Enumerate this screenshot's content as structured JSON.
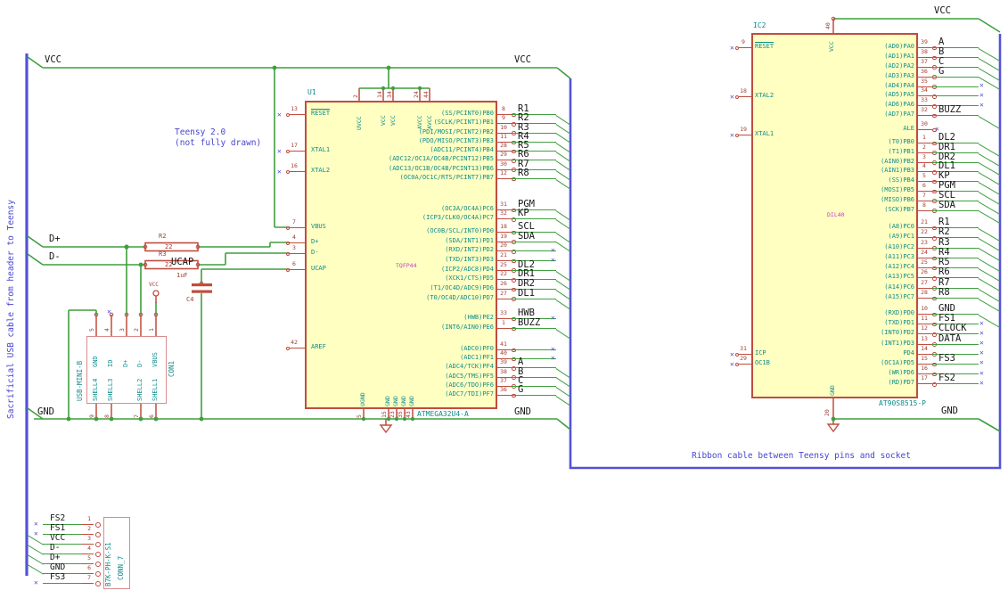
{
  "notes": {
    "teensy_line1": "Teensy 2.0",
    "teensy_line2": "(not fully drawn)",
    "ribbon": "Ribbon cable between Teensy pins and socket",
    "sacrificial": "Sacrificial USB cable from header to Teensy"
  },
  "net_labels": {
    "vcc": "VCC",
    "gnd": "GND",
    "d_plus": "D+",
    "d_minus": "D-",
    "ucap": "UCAP"
  },
  "colors": {
    "wire": "#3f9f3f",
    "bus": "#5353d6",
    "pin_outline": "#bf4d3f",
    "body_fill": "#ffffc2",
    "pin_name": "#0e8c8c",
    "pin_number": "#a33c32",
    "net_label": "#161616",
    "note_blue": "#4646cf",
    "footprint_magenta": "#c43fc4"
  },
  "u1": {
    "ref": "U1",
    "value": "ATMEGA32U4-A",
    "footprint": "TQFP44",
    "top_pins": [
      {
        "num": "2",
        "name": "UVCC"
      },
      {
        "num": "14",
        "name": "VCC"
      },
      {
        "num": "34",
        "name": "VCC"
      },
      {
        "num": "24",
        "name": "AVCC"
      },
      {
        "num": "44",
        "name": "AVCC"
      }
    ],
    "bottom_pins": [
      {
        "num": "5",
        "name": "UGND"
      },
      {
        "num": "15",
        "name": "GND"
      },
      {
        "num": "23",
        "name": "GND"
      },
      {
        "num": "35",
        "name": "GND"
      },
      {
        "num": "43",
        "name": "GND"
      }
    ],
    "left_pins": [
      {
        "num": "13",
        "name": "RESET"
      },
      {
        "num": "17",
        "name": "XTAL1"
      },
      {
        "num": "16",
        "name": "XTAL2"
      },
      {
        "num": "7",
        "name": "VBUS"
      },
      {
        "num": "4",
        "name": "D+"
      },
      {
        "num": "3",
        "name": "D-"
      },
      {
        "num": "6",
        "name": "UCAP"
      },
      {
        "num": "42",
        "name": "AREF"
      }
    ],
    "right_groups": [
      {
        "rows": [
          {
            "name": "(SS/PCINT0)PB0",
            "num": "8",
            "net": "R1",
            "entry": true
          },
          {
            "name": "(SCLK/PCINT1)PB1",
            "num": "9",
            "net": "R2",
            "entry": true
          },
          {
            "name": "(PDI/MOSI/PCINT2)PB2",
            "num": "10",
            "net": "R3",
            "entry": true
          },
          {
            "name": "(PDO/MISO/PCINT3)PB3",
            "num": "11",
            "net": "R4",
            "entry": true
          },
          {
            "name": "(ADC11/PCINT4)PB4",
            "num": "28",
            "net": "R5",
            "entry": true
          },
          {
            "name": "(ADC12/OC1A/OC4B/PCINT12)PB5",
            "num": "29",
            "net": "R6",
            "entry": true
          },
          {
            "name": "(ADC13/OC1B/OC4B/PCINT13)PB6",
            "num": "30",
            "net": "R7",
            "entry": true
          },
          {
            "name": "(OC0A/OC1C/RTS/PCINT7)PB7",
            "num": "12",
            "net": "R8",
            "entry": true
          }
        ]
      },
      {
        "rows": [
          {
            "name": "(OC3A/OC4A)PC6",
            "num": "31",
            "net": "PGM",
            "entry": true
          },
          {
            "name": "(ICP3/CLK0/OC4A)PC7",
            "num": "32",
            "net": "KP",
            "entry": true
          }
        ]
      },
      {
        "rows": [
          {
            "name": "(OC0B/SCL/INT0)PD0",
            "num": "18",
            "net": "SCL",
            "entry": true
          },
          {
            "name": "(SDA/INT1)PD1",
            "num": "19",
            "net": "SDA",
            "entry": true
          },
          {
            "name": "(RXD/INT2)PD2",
            "num": "20",
            "nc": true
          },
          {
            "name": "(TXD/INT3)PD3",
            "num": "21",
            "nc": true
          },
          {
            "name": "(ICP2/ADC8)PD4",
            "num": "25",
            "net": "DL2",
            "entry": true
          },
          {
            "name": "(XCK1/CTS)PD5",
            "num": "22",
            "net": "DR1",
            "entry": true
          },
          {
            "name": "(T1/OC4D/ADC9)PD6",
            "num": "26",
            "net": "DR2",
            "entry": true
          },
          {
            "name": "(T0/OC4D/ADC10)PD7",
            "num": "27",
            "net": "DL1",
            "entry": true
          }
        ]
      },
      {
        "rows": [
          {
            "name": "(HWB)PE2",
            "num": "33",
            "net": "HWB",
            "nc": true
          },
          {
            "name": "(INT6/AIN0)PE6",
            "num": "1",
            "net": "BUZZ",
            "entry": true
          }
        ]
      },
      {
        "rows": [
          {
            "name": "(ADC0)PF0",
            "num": "41",
            "nc": true
          },
          {
            "name": "(ADC1)PF1",
            "num": "40",
            "nc": true
          },
          {
            "name": "(ADC4/TCK)PF4",
            "num": "39",
            "net": "A",
            "entry": true
          },
          {
            "name": "(ADC5/TMS)PF5",
            "num": "38",
            "net": "B",
            "entry": true
          },
          {
            "name": "(ADC6/TDO)PF6",
            "num": "37",
            "net": "C",
            "entry": true
          },
          {
            "name": "(ADC7/TDI)PF7",
            "num": "36",
            "net": "G",
            "entry": true
          }
        ]
      }
    ]
  },
  "ic2": {
    "ref": "IC2",
    "value": "AT90S8515-P",
    "footprint": "DIL40",
    "top_pin": {
      "num": "40",
      "name": "VCC"
    },
    "bottom_pin": {
      "num": "20",
      "name": "GND"
    },
    "ale_pin": {
      "name": "ALE",
      "num": "30"
    },
    "left_pins": [
      {
        "num": "9",
        "name": "RESET"
      },
      {
        "num": "18",
        "name": "XTAL2"
      },
      {
        "num": "19",
        "name": "XTAL1"
      },
      {
        "num": "31",
        "name": "ICP"
      },
      {
        "num": "29",
        "name": "OC1B"
      }
    ],
    "right_groups": [
      {
        "rows": [
          {
            "name": "(AD0)PA0",
            "num": "39",
            "net": "A",
            "entry": true
          },
          {
            "name": "(AD1)PA1",
            "num": "38",
            "net": "B",
            "entry": true
          },
          {
            "name": "(AD2)PA2",
            "num": "37",
            "net": "C",
            "entry": true
          },
          {
            "name": "(AD3)PA3",
            "num": "36",
            "net": "G",
            "entry": true
          },
          {
            "name": "(AD4)PA4",
            "num": "35",
            "nc": true
          },
          {
            "name": "(AD5)PA5",
            "num": "34",
            "nc": true
          },
          {
            "name": "(AD6)PA6",
            "num": "33",
            "nc": true
          },
          {
            "name": "(AD7)PA7",
            "num": "32",
            "net": "BUZZ",
            "entry": true
          }
        ]
      },
      {
        "rows": [
          {
            "name": "(T0)PB0",
            "num": "1",
            "net": "DL2",
            "entry": true
          },
          {
            "name": "(T1)PB1",
            "num": "2",
            "net": "DR1",
            "entry": true
          },
          {
            "name": "(AIN0)PB2",
            "num": "3",
            "net": "DR2",
            "entry": true
          },
          {
            "name": "(AIN1)PB3",
            "num": "4",
            "net": "DL1",
            "entry": true
          },
          {
            "name": "(SS)PB4",
            "num": "5",
            "net": "KP",
            "entry": true
          },
          {
            "name": "(MOSI)PB5",
            "num": "6",
            "net": "PGM",
            "entry": true
          },
          {
            "name": "(MISO)PB6",
            "num": "7",
            "net": "SCL",
            "entry": true
          },
          {
            "name": "(SCK)PB7",
            "num": "8",
            "net": "SDA",
            "entry": true
          }
        ]
      },
      {
        "rows": [
          {
            "name": "(A8)PC0",
            "num": "21",
            "net": "R1",
            "entry": true
          },
          {
            "name": "(A9)PC1",
            "num": "22",
            "net": "R2",
            "entry": true
          },
          {
            "name": "(A10)PC2",
            "num": "23",
            "net": "R3",
            "entry": true
          },
          {
            "name": "(A11)PC3",
            "num": "24",
            "net": "R4",
            "entry": true
          },
          {
            "name": "(A12)PC4",
            "num": "25",
            "net": "R5",
            "entry": true
          },
          {
            "name": "(A13)PC5",
            "num": "26",
            "net": "R6",
            "entry": true
          },
          {
            "name": "(A14)PC6",
            "num": "27",
            "net": "R7",
            "entry": true
          },
          {
            "name": "(A15)PC7",
            "num": "28",
            "net": "R8",
            "entry": true
          }
        ]
      },
      {
        "rows": [
          {
            "name": "(RXD)PD0",
            "num": "10",
            "net": "GND",
            "entry": true
          },
          {
            "name": "(TXD)PD1",
            "num": "11",
            "net": "FS1",
            "nc": true
          },
          {
            "name": "(INT0)PD2",
            "num": "12",
            "net": "CLOCK",
            "nc": true
          },
          {
            "name": "(INT1)PD3",
            "num": "13",
            "net": "DATA",
            "nc": true
          },
          {
            "name": "PD4",
            "num": "14",
            "nc": true
          },
          {
            "name": "(OC1A)PD5",
            "num": "15",
            "net": "FS3",
            "nc": true
          },
          {
            "name": "(WR)PD6",
            "num": "16",
            "nc": true
          },
          {
            "name": "(RD)PD7",
            "num": "17",
            "net": "FS2",
            "nc": true
          }
        ]
      }
    ]
  },
  "usb": {
    "ref": "CON1",
    "value": "USB-MINI-B",
    "top_pins": [
      {
        "num": "5",
        "name": "GND"
      },
      {
        "num": "4",
        "name": "ID"
      },
      {
        "num": "3",
        "name": "D+"
      },
      {
        "num": "2",
        "name": "D-"
      },
      {
        "num": "1",
        "name": "VBUS"
      }
    ],
    "bottom_pins": [
      {
        "num": "9",
        "name": "SHELL4"
      },
      {
        "num": "8",
        "name": "SHELL3"
      },
      {
        "num": "7",
        "name": "SHELL2"
      },
      {
        "num": "6",
        "name": "SHELL1"
      }
    ]
  },
  "conn7": {
    "ref": "CONN_7",
    "value": "B7K-PH-K-S1",
    "rows": [
      {
        "num": "1",
        "net": "FS2",
        "nc": true
      },
      {
        "num": "2",
        "net": "FS1",
        "nc": true
      },
      {
        "num": "3",
        "net": "VCC",
        "entry": true
      },
      {
        "num": "4",
        "net": "D-",
        "entry": true
      },
      {
        "num": "5",
        "net": "D+",
        "entry": true
      },
      {
        "num": "6",
        "net": "GND",
        "entry": true
      },
      {
        "num": "7",
        "net": "FS3",
        "nc": true
      }
    ]
  },
  "r2": {
    "ref": "R2",
    "value": "22"
  },
  "r3": {
    "ref": "R3",
    "value": "22"
  },
  "c4": {
    "ref": "C4",
    "value": "1uF"
  },
  "vcc_symbol": {
    "label": "VCC"
  }
}
